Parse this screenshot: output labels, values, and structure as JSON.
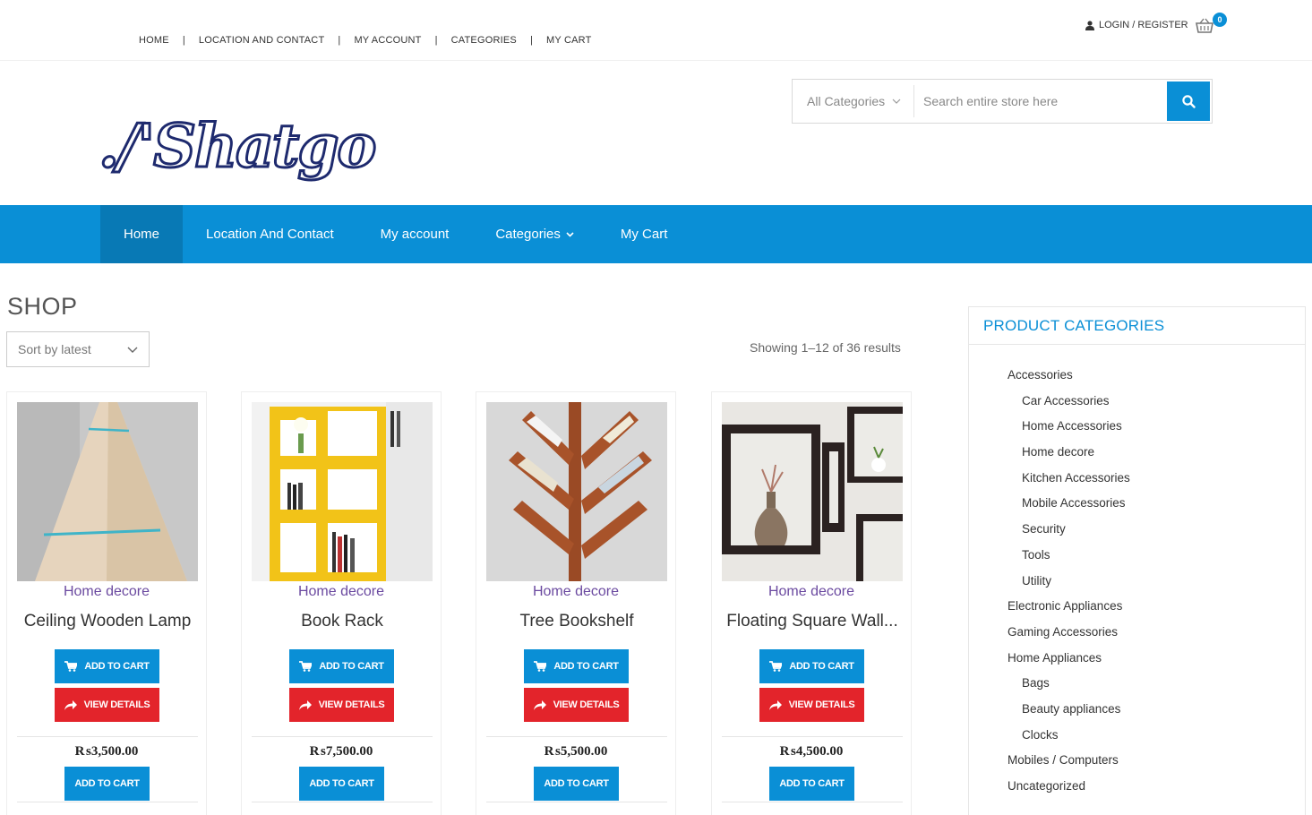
{
  "topnav": {
    "links": [
      "HOME",
      "LOCATION AND CONTACT",
      "MY ACCOUNT",
      "CATEGORIES",
      "MY CART"
    ],
    "login_label": "LOGIN / REGISTER",
    "cart_count": "0"
  },
  "header": {
    "logo_text": "./'Shatgo",
    "category_select": "All Categories",
    "search_placeholder": "Search entire store here"
  },
  "mainnav": {
    "items": [
      "Home",
      "Location And Contact",
      "My account",
      "Categories",
      "My Cart"
    ]
  },
  "shop": {
    "title": "SHOP",
    "sort_label": "Sort by latest",
    "result_count": "Showing 1–12 of 36 results",
    "products": [
      {
        "category": "Home decore",
        "name": "Ceiling Wooden Lamp",
        "price": "₨3,500.00",
        "add_to_cart": "ADD TO CART",
        "view_details": "VIEW DETAILS",
        "add_to_cart_2": "ADD TO CART"
      },
      {
        "category": "Home decore",
        "name": "Book Rack",
        "price": "₨7,500.00",
        "add_to_cart": "ADD TO CART",
        "view_details": "VIEW DETAILS",
        "add_to_cart_2": "ADD TO CART"
      },
      {
        "category": "Home decore",
        "name": "Tree Bookshelf",
        "price": "₨5,500.00",
        "add_to_cart": "ADD TO CART",
        "view_details": "VIEW DETAILS",
        "add_to_cart_2": "ADD TO CART"
      },
      {
        "category": "Home decore",
        "name": "Floating Square Wall...",
        "price": "₨4,500.00",
        "add_to_cart": "ADD TO CART",
        "view_details": "VIEW DETAILS",
        "add_to_cart_2": "ADD TO CART"
      }
    ]
  },
  "sidebar": {
    "title": "PRODUCT CATEGORIES",
    "categories": [
      {
        "label": "Accessories",
        "sub": false
      },
      {
        "label": "Car Accessories",
        "sub": true
      },
      {
        "label": "Home Accessories",
        "sub": true
      },
      {
        "label": "Home decore",
        "sub": true
      },
      {
        "label": "Kitchen Accessories",
        "sub": true
      },
      {
        "label": "Mobile Accessories",
        "sub": true
      },
      {
        "label": "Security",
        "sub": true
      },
      {
        "label": "Tools",
        "sub": true
      },
      {
        "label": "Utility",
        "sub": true
      },
      {
        "label": "Electronic Appliances",
        "sub": false
      },
      {
        "label": "Gaming Accessories",
        "sub": false
      },
      {
        "label": "Home Appliances",
        "sub": false
      },
      {
        "label": "Bags",
        "sub": true
      },
      {
        "label": "Beauty appliances",
        "sub": true
      },
      {
        "label": "Clocks",
        "sub": true
      },
      {
        "label": "Mobiles / Computers",
        "sub": false
      },
      {
        "label": "Uncategorized",
        "sub": false
      }
    ]
  },
  "colors": {
    "primary": "#0a8fd6",
    "primary_dark": "#0879b5",
    "danger": "#e3242b",
    "category_link": "#6b4aa0"
  }
}
